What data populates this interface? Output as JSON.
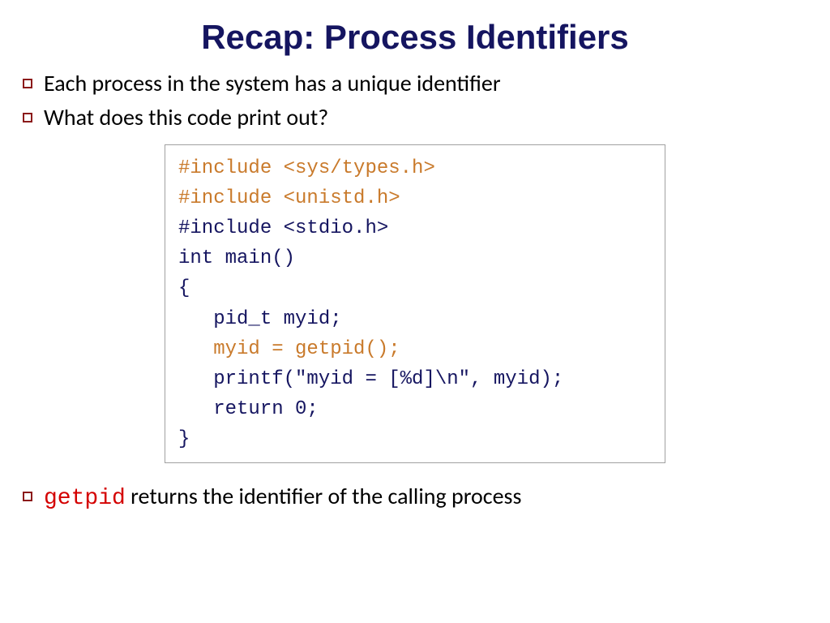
{
  "title": "Recap: Process Identifiers",
  "bullets": {
    "b1": "Each process in the system has a unique identifier",
    "b2": "What does this code print out?"
  },
  "code": {
    "l1": "#include <sys/types.h>",
    "l2": "#include <unistd.h>",
    "l3": "#include <stdio.h>",
    "l4": "int main()",
    "l5": "{",
    "l6": "   pid_t myid;",
    "l7": "",
    "l8": "   myid = getpid();",
    "l9": "   printf(\"myid = [%d]\\n\", myid);",
    "l10": "   return 0;",
    "l11": "}"
  },
  "footer": {
    "mono": "getpid",
    "rest": " returns the identifier of the calling process"
  }
}
